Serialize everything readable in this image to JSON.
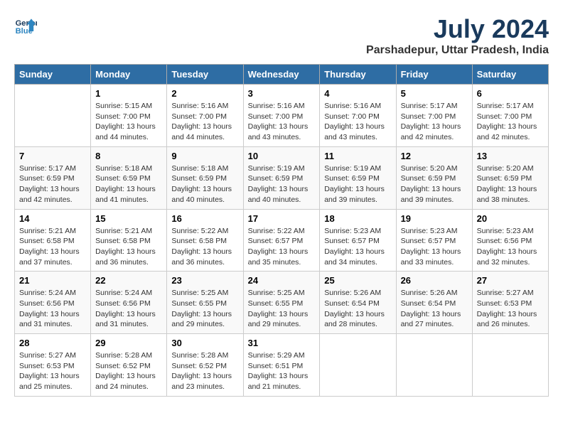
{
  "header": {
    "logo_line1": "General",
    "logo_line2": "Blue",
    "month_year": "July 2024",
    "location": "Parshadepur, Uttar Pradesh, India"
  },
  "weekdays": [
    "Sunday",
    "Monday",
    "Tuesday",
    "Wednesday",
    "Thursday",
    "Friday",
    "Saturday"
  ],
  "weeks": [
    [
      {
        "day": "",
        "info": ""
      },
      {
        "day": "1",
        "info": "Sunrise: 5:15 AM\nSunset: 7:00 PM\nDaylight: 13 hours\nand 44 minutes."
      },
      {
        "day": "2",
        "info": "Sunrise: 5:16 AM\nSunset: 7:00 PM\nDaylight: 13 hours\nand 44 minutes."
      },
      {
        "day": "3",
        "info": "Sunrise: 5:16 AM\nSunset: 7:00 PM\nDaylight: 13 hours\nand 43 minutes."
      },
      {
        "day": "4",
        "info": "Sunrise: 5:16 AM\nSunset: 7:00 PM\nDaylight: 13 hours\nand 43 minutes."
      },
      {
        "day": "5",
        "info": "Sunrise: 5:17 AM\nSunset: 7:00 PM\nDaylight: 13 hours\nand 42 minutes."
      },
      {
        "day": "6",
        "info": "Sunrise: 5:17 AM\nSunset: 7:00 PM\nDaylight: 13 hours\nand 42 minutes."
      }
    ],
    [
      {
        "day": "7",
        "info": "Sunrise: 5:17 AM\nSunset: 6:59 PM\nDaylight: 13 hours\nand 42 minutes."
      },
      {
        "day": "8",
        "info": "Sunrise: 5:18 AM\nSunset: 6:59 PM\nDaylight: 13 hours\nand 41 minutes."
      },
      {
        "day": "9",
        "info": "Sunrise: 5:18 AM\nSunset: 6:59 PM\nDaylight: 13 hours\nand 40 minutes."
      },
      {
        "day": "10",
        "info": "Sunrise: 5:19 AM\nSunset: 6:59 PM\nDaylight: 13 hours\nand 40 minutes."
      },
      {
        "day": "11",
        "info": "Sunrise: 5:19 AM\nSunset: 6:59 PM\nDaylight: 13 hours\nand 39 minutes."
      },
      {
        "day": "12",
        "info": "Sunrise: 5:20 AM\nSunset: 6:59 PM\nDaylight: 13 hours\nand 39 minutes."
      },
      {
        "day": "13",
        "info": "Sunrise: 5:20 AM\nSunset: 6:59 PM\nDaylight: 13 hours\nand 38 minutes."
      }
    ],
    [
      {
        "day": "14",
        "info": "Sunrise: 5:21 AM\nSunset: 6:58 PM\nDaylight: 13 hours\nand 37 minutes."
      },
      {
        "day": "15",
        "info": "Sunrise: 5:21 AM\nSunset: 6:58 PM\nDaylight: 13 hours\nand 36 minutes."
      },
      {
        "day": "16",
        "info": "Sunrise: 5:22 AM\nSunset: 6:58 PM\nDaylight: 13 hours\nand 36 minutes."
      },
      {
        "day": "17",
        "info": "Sunrise: 5:22 AM\nSunset: 6:57 PM\nDaylight: 13 hours\nand 35 minutes."
      },
      {
        "day": "18",
        "info": "Sunrise: 5:23 AM\nSunset: 6:57 PM\nDaylight: 13 hours\nand 34 minutes."
      },
      {
        "day": "19",
        "info": "Sunrise: 5:23 AM\nSunset: 6:57 PM\nDaylight: 13 hours\nand 33 minutes."
      },
      {
        "day": "20",
        "info": "Sunrise: 5:23 AM\nSunset: 6:56 PM\nDaylight: 13 hours\nand 32 minutes."
      }
    ],
    [
      {
        "day": "21",
        "info": "Sunrise: 5:24 AM\nSunset: 6:56 PM\nDaylight: 13 hours\nand 31 minutes."
      },
      {
        "day": "22",
        "info": "Sunrise: 5:24 AM\nSunset: 6:56 PM\nDaylight: 13 hours\nand 31 minutes."
      },
      {
        "day": "23",
        "info": "Sunrise: 5:25 AM\nSunset: 6:55 PM\nDaylight: 13 hours\nand 29 minutes."
      },
      {
        "day": "24",
        "info": "Sunrise: 5:25 AM\nSunset: 6:55 PM\nDaylight: 13 hours\nand 29 minutes."
      },
      {
        "day": "25",
        "info": "Sunrise: 5:26 AM\nSunset: 6:54 PM\nDaylight: 13 hours\nand 28 minutes."
      },
      {
        "day": "26",
        "info": "Sunrise: 5:26 AM\nSunset: 6:54 PM\nDaylight: 13 hours\nand 27 minutes."
      },
      {
        "day": "27",
        "info": "Sunrise: 5:27 AM\nSunset: 6:53 PM\nDaylight: 13 hours\nand 26 minutes."
      }
    ],
    [
      {
        "day": "28",
        "info": "Sunrise: 5:27 AM\nSunset: 6:53 PM\nDaylight: 13 hours\nand 25 minutes."
      },
      {
        "day": "29",
        "info": "Sunrise: 5:28 AM\nSunset: 6:52 PM\nDaylight: 13 hours\nand 24 minutes."
      },
      {
        "day": "30",
        "info": "Sunrise: 5:28 AM\nSunset: 6:52 PM\nDaylight: 13 hours\nand 23 minutes."
      },
      {
        "day": "31",
        "info": "Sunrise: 5:29 AM\nSunset: 6:51 PM\nDaylight: 13 hours\nand 21 minutes."
      },
      {
        "day": "",
        "info": ""
      },
      {
        "day": "",
        "info": ""
      },
      {
        "day": "",
        "info": ""
      }
    ]
  ]
}
